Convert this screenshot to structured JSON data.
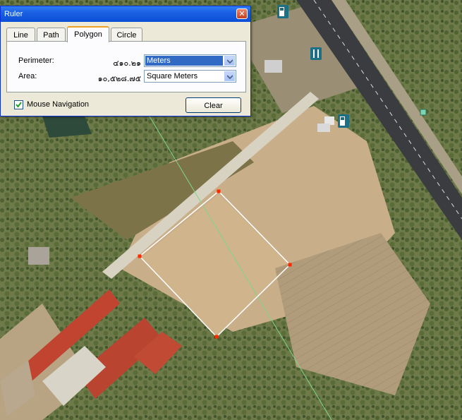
{
  "window": {
    "title": "Ruler",
    "close_glyph": "✕"
  },
  "tabs": [
    {
      "label": "Line",
      "active": false
    },
    {
      "label": "Path",
      "active": false
    },
    {
      "label": "Polygon",
      "active": true
    },
    {
      "label": "Circle",
      "active": false
    }
  ],
  "measurements": {
    "perimeter": {
      "label": "Perimeter:",
      "value": "๔๑๐.๒๑",
      "unit": "Meters"
    },
    "area": {
      "label": "Area:",
      "value": "๑๐,๕๒๘.๗๕",
      "unit": "Square Meters"
    }
  },
  "mouse_navigation": {
    "label": "Mouse Navigation",
    "checked": true
  },
  "clear_label": "Clear",
  "icons": [
    "close-icon",
    "fuel-station-icon",
    "restaurant-icon",
    "chevron-down-icon",
    "checkmark-icon"
  ]
}
